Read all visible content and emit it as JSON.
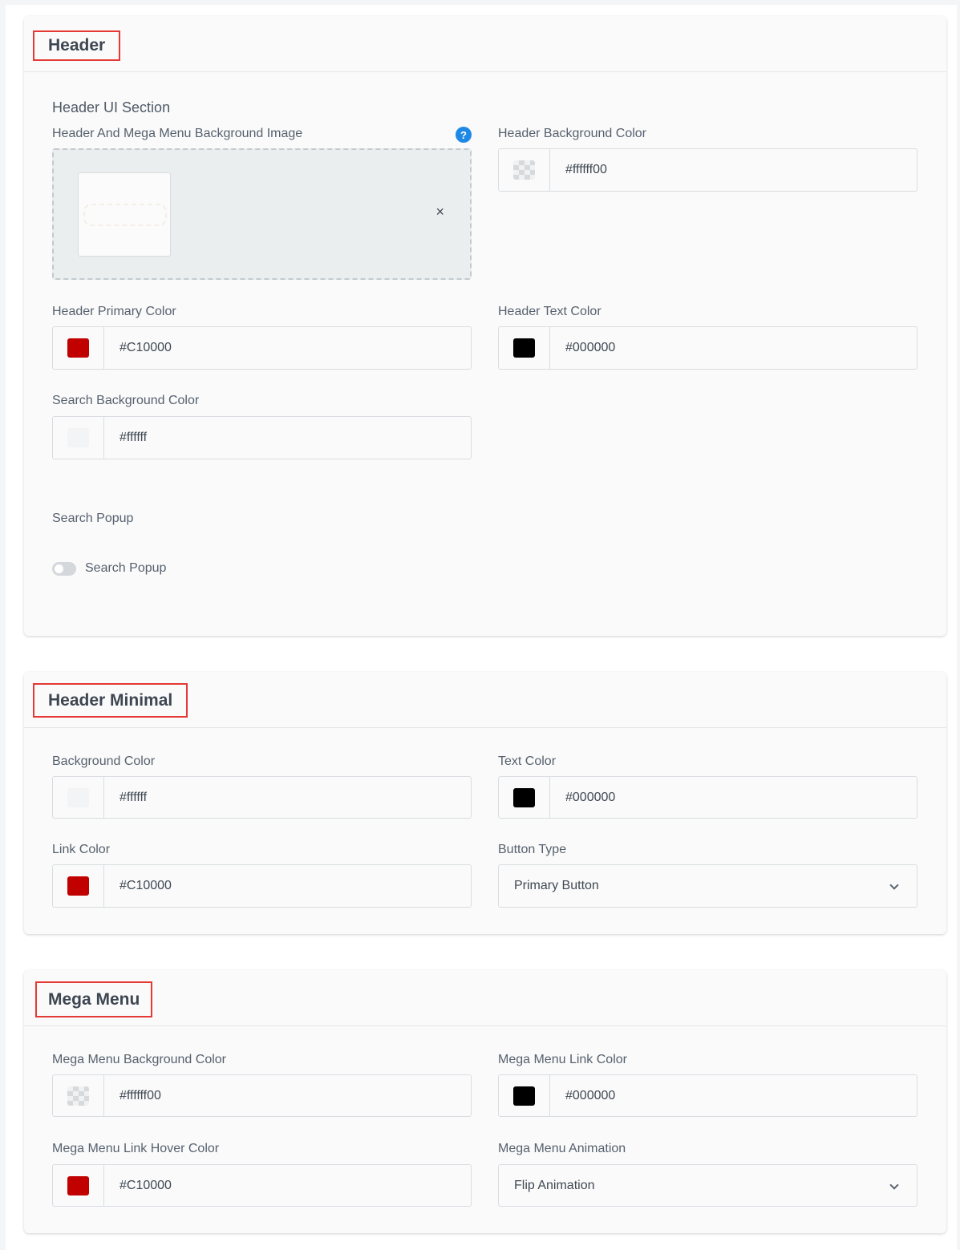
{
  "colors": {
    "accent_red": "#C10000",
    "black": "#000000",
    "title_border": "#e53935",
    "help_blue": "#1e88e5"
  },
  "header": {
    "title": "Header",
    "ui_section_label": "Header UI Section",
    "bg_image_label": "Header And Mega Menu Background Image",
    "help_icon_glyph": "?",
    "remove_icon_glyph": "×",
    "bg_color_label": "Header Background Color",
    "bg_color_value": "#ffffff00",
    "primary_color_label": "Header Primary Color",
    "primary_color_value": "#C10000",
    "text_color_label": "Header Text Color",
    "text_color_value": "#000000",
    "search_bg_label": "Search Background Color",
    "search_bg_value": "#ffffff",
    "search_popup_section_label": "Search Popup",
    "search_popup_toggle_label": "Search Popup",
    "search_popup_enabled": false
  },
  "header_minimal": {
    "title": "Header Minimal",
    "bg_color_label": "Background Color",
    "bg_color_value": "#ffffff",
    "text_color_label": "Text Color",
    "text_color_value": "#000000",
    "link_color_label": "Link Color",
    "link_color_value": "#C10000",
    "button_type_label": "Button Type",
    "button_type_value": "Primary Button"
  },
  "mega_menu": {
    "title": "Mega Menu",
    "bg_color_label": "Mega Menu Background Color",
    "bg_color_value": "#ffffff00",
    "link_color_label": "Mega Menu Link Color",
    "link_color_value": "#000000",
    "link_hover_label": "Mega Menu Link Hover Color",
    "link_hover_value": "#C10000",
    "animation_label": "Mega Menu Animation",
    "animation_value": "Flip Animation"
  }
}
